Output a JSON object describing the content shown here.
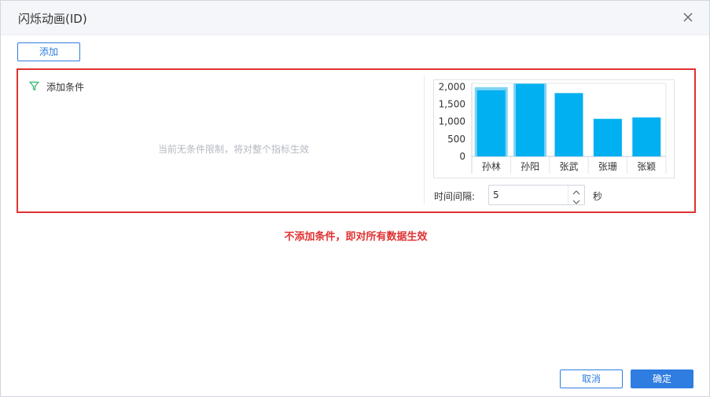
{
  "dialog": {
    "title": "闪烁动画(ID)"
  },
  "toolbar": {
    "add_label": "添加"
  },
  "conditions": {
    "header_label": "添加条件",
    "empty_text": "当前无条件限制，将对整个指标生效"
  },
  "interval": {
    "label": "时间间隔:",
    "value": "5",
    "unit": "秒"
  },
  "annotation": "不添加条件，即对所有数据生效",
  "footer": {
    "cancel_label": "取消",
    "ok_label": "确定"
  },
  "colors": {
    "accent": "#2f7de1",
    "highlight": "#e03131",
    "bar": "#00b0f0",
    "bar_halo": "#7fd3f5",
    "filter_icon": "#2db56b"
  },
  "icons": {
    "filter": "filter-icon",
    "close": "close-icon",
    "spin_up": "chevron-up-icon",
    "spin_down": "chevron-down-icon"
  },
  "chart_data": {
    "type": "bar",
    "categories": [
      "孙林",
      "孙阳",
      "张武",
      "张珊",
      "张颖"
    ],
    "values": [
      1900,
      2080,
      1820,
      1080,
      1120
    ],
    "y_ticks": [
      "2,000",
      "1,500",
      "1,000",
      "500",
      "0"
    ],
    "y_tick_values": [
      2000,
      1500,
      1000,
      500,
      0
    ],
    "ylim": [
      0,
      2100
    ],
    "highlighted": [
      0,
      1
    ],
    "grid": false,
    "title": "",
    "xlabel": "",
    "ylabel": ""
  }
}
